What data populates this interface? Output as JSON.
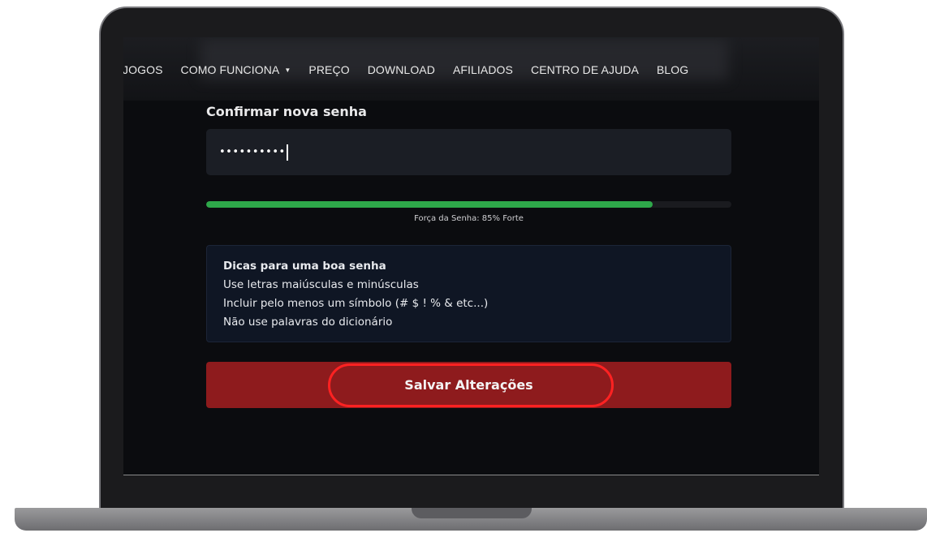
{
  "nav": {
    "items": [
      "JOGOS",
      "COMO FUNCIONA",
      "PREÇO",
      "DOWNLOAD",
      "AFILIADOS",
      "CENTRO DE AJUDA",
      "BLOG"
    ]
  },
  "form": {
    "confirm_label": "Confirmar nova senha",
    "password_value": "••••••••••"
  },
  "strength": {
    "percent": 85,
    "text": "Força da Senha: 85% Forte",
    "color": "#2ea84a"
  },
  "tips": {
    "title": "Dicas para uma boa senha",
    "lines": [
      "Use letras maiúsculas e minúsculas",
      "Incluir pelo menos um símbolo (# $ ! % & etc...)",
      "Não use palavras do dicionário"
    ]
  },
  "save_button": {
    "label": "Salvar Alterações",
    "color": "#8e1b1d",
    "highlight_color": "#ff2222"
  }
}
